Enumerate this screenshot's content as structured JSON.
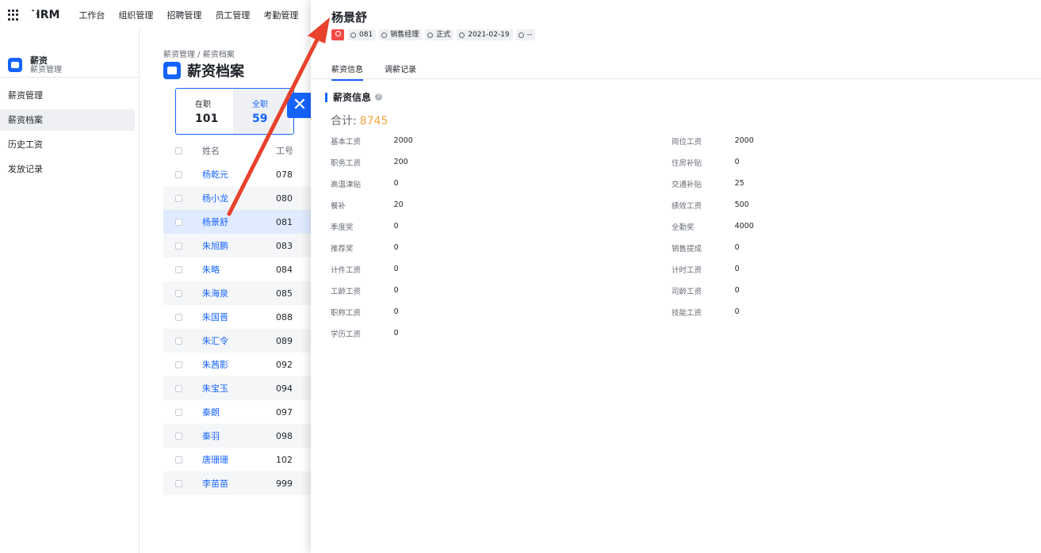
{
  "topbar": {
    "brand": "HRM",
    "nav": [
      "工作台",
      "组织管理",
      "招聘管理",
      "员工管理",
      "考勤管理"
    ]
  },
  "sidebar": {
    "title": "薪资",
    "subtitle": "薪资管理",
    "items": [
      {
        "label": "薪资管理",
        "active": false
      },
      {
        "label": "薪资档案",
        "active": true
      },
      {
        "label": "历史工资",
        "active": false
      },
      {
        "label": "发放记录",
        "active": false
      }
    ]
  },
  "content": {
    "breadcrumb": "薪资管理  /  薪资档案",
    "title": "薪资档案",
    "stats": [
      {
        "label": "在职",
        "value": "101"
      },
      {
        "label": "全职",
        "value": "59"
      }
    ],
    "table": {
      "headers": [
        "姓名",
        "工号"
      ],
      "rows": [
        {
          "name": "杨乾元",
          "id": "078"
        },
        {
          "name": "杨小龙",
          "id": "080"
        },
        {
          "name": "杨景舒",
          "id": "081"
        },
        {
          "name": "朱旭鹏",
          "id": "083"
        },
        {
          "name": "朱略",
          "id": "084"
        },
        {
          "name": "朱海泉",
          "id": "085"
        },
        {
          "name": "朱国晋",
          "id": "088"
        },
        {
          "name": "朱汇令",
          "id": "089"
        },
        {
          "name": "朱茜影",
          "id": "092"
        },
        {
          "name": "朱宝玉",
          "id": "094"
        },
        {
          "name": "秦朗",
          "id": "097"
        },
        {
          "name": "秦羽",
          "id": "098"
        },
        {
          "name": "唐珊珊",
          "id": "102"
        },
        {
          "name": "李苗苗",
          "id": "999"
        }
      ]
    }
  },
  "drawer": {
    "name": "杨景舒",
    "tags": [
      "081",
      "销售经理",
      "正式",
      "2021-02-19",
      "--"
    ],
    "tabs": [
      "薪资信息",
      "调薪记录"
    ],
    "section_title": "薪资信息",
    "total_label": "合计:",
    "total_value": "8745",
    "fields": [
      [
        "基本工资",
        "2000",
        "岗位工资",
        "2000"
      ],
      [
        "职务工资",
        "200",
        "住房补贴",
        "0"
      ],
      [
        "高温津贴",
        "0",
        "交通补贴",
        "25"
      ],
      [
        "餐补",
        "20",
        "绩效工资",
        "500"
      ],
      [
        "季度奖",
        "0",
        "全勤奖",
        "4000"
      ],
      [
        "推荐奖",
        "0",
        "销售提成",
        "0"
      ],
      [
        "计件工资",
        "0",
        "计时工资",
        "0"
      ],
      [
        "工龄工资",
        "0",
        "司龄工资",
        "0"
      ],
      [
        "职称工资",
        "0",
        "技能工资",
        "0"
      ],
      [
        "学历工资",
        "0",
        "",
        ""
      ]
    ]
  },
  "colors": {
    "accent": "#1664ff",
    "total": "#f7a53c",
    "arrow": "#e8412c"
  }
}
